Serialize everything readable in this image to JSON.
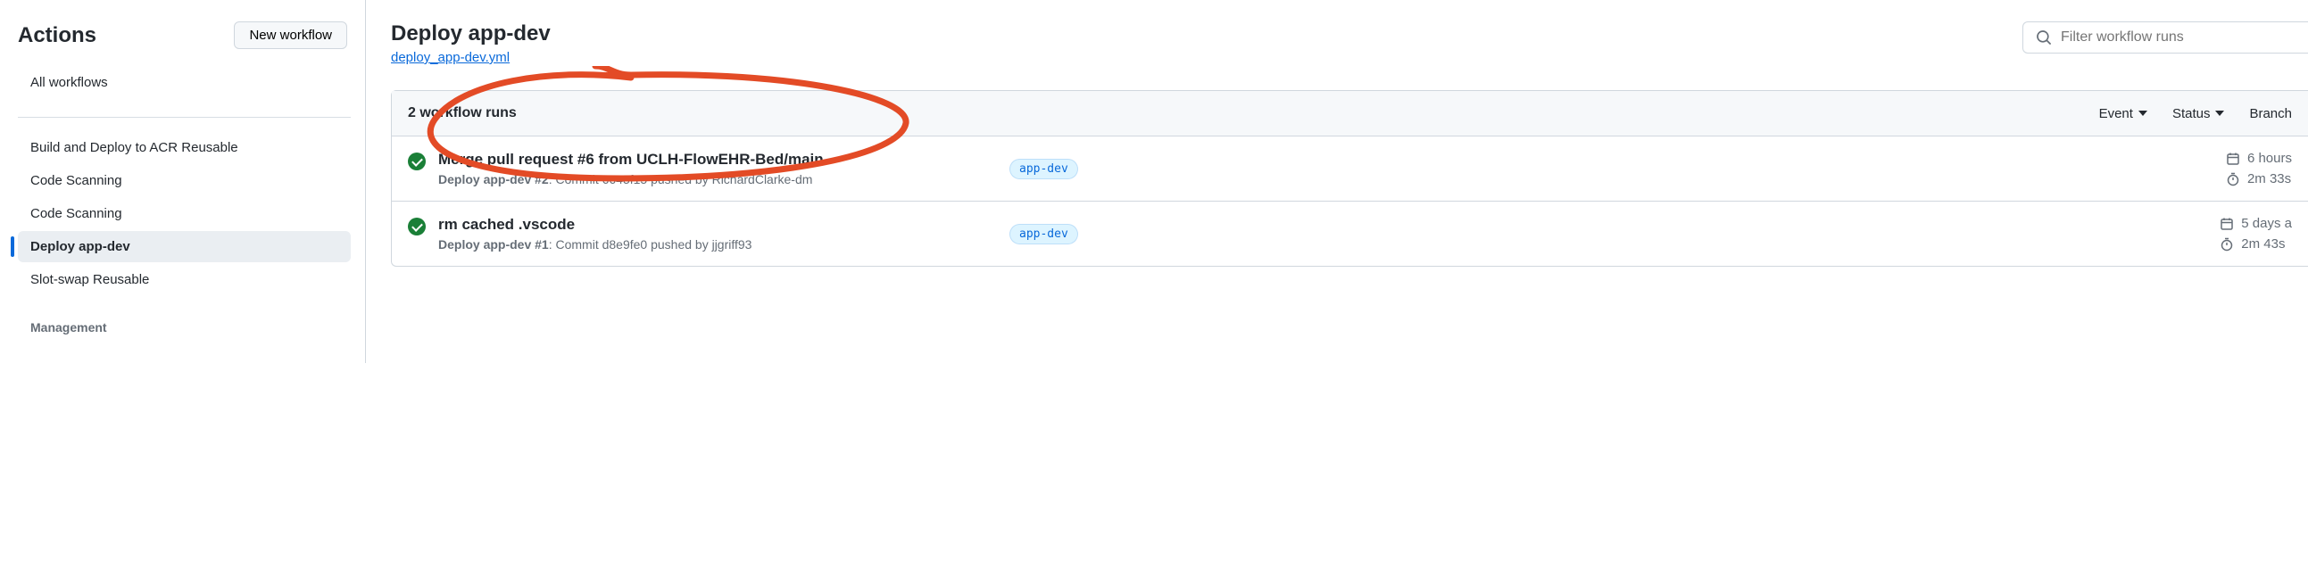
{
  "sidebar": {
    "title": "Actions",
    "new_workflow_label": "New workflow",
    "all_workflows_label": "All workflows",
    "items": [
      {
        "label": "Build and Deploy to ACR Reusable"
      },
      {
        "label": "Code Scanning"
      },
      {
        "label": "Code Scanning"
      },
      {
        "label": "Deploy app-dev",
        "active": true
      },
      {
        "label": "Slot-swap Reusable"
      }
    ],
    "management_label": "Management"
  },
  "main": {
    "title": "Deploy app-dev",
    "file_link": "deploy_app-dev.yml",
    "filter_placeholder": "Filter workflow runs",
    "runs_count_label": "2 workflow runs",
    "filters": {
      "event": "Event",
      "status": "Status",
      "branch": "Branch"
    },
    "runs": [
      {
        "title": "Merge pull request #6 from UCLH-FlowEHR-Bed/main",
        "workflow_and_num": "Deploy app-dev #2",
        "commit_label": "Commit 6645f15 pushed by RichardClarke-dm",
        "branch": "app-dev",
        "age": "6 hours",
        "duration": "2m 33s"
      },
      {
        "title": "rm cached .vscode",
        "workflow_and_num": "Deploy app-dev #1",
        "commit_label": "Commit d8e9fe0 pushed by jjgriff93",
        "branch": "app-dev",
        "age": "5 days a",
        "duration": "2m 43s"
      }
    ]
  }
}
